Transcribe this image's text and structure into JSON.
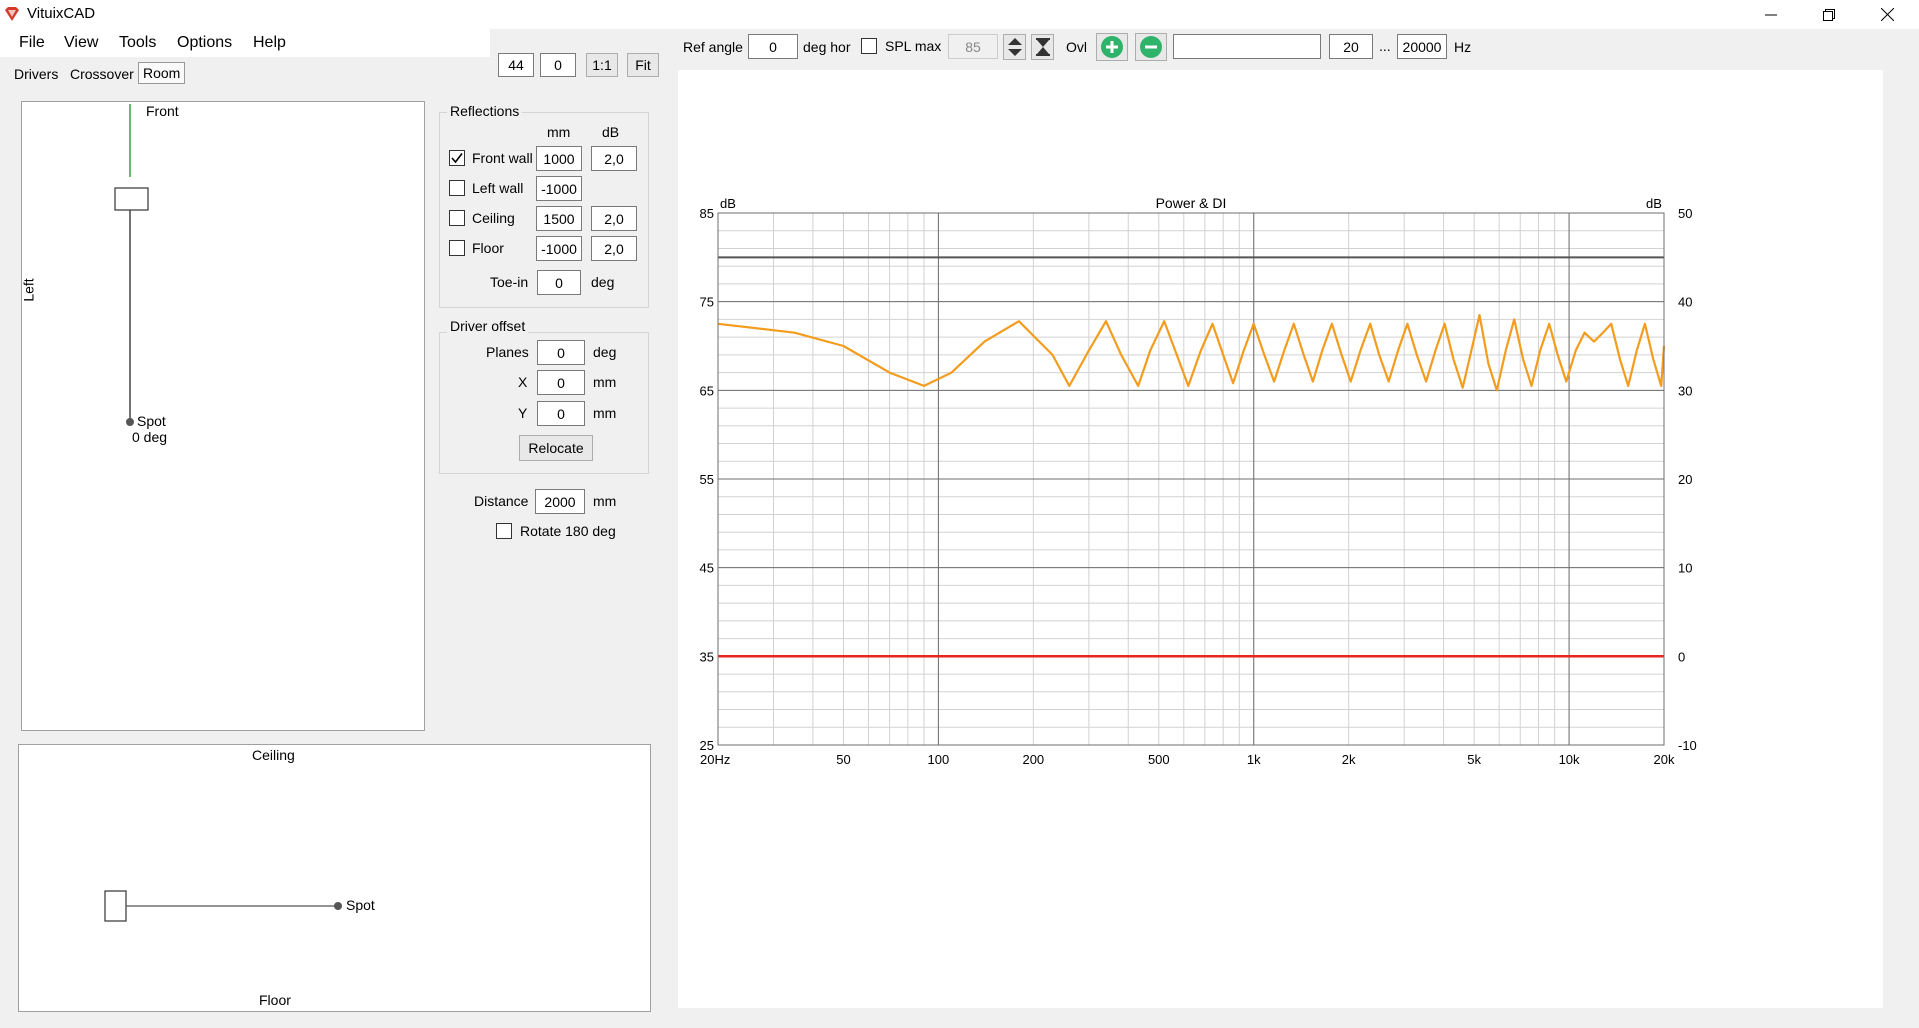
{
  "app": {
    "title": "VituixCAD"
  },
  "menu": [
    "File",
    "View",
    "Tools",
    "Options",
    "Help"
  ],
  "tabs": [
    "Drivers",
    "Crossover",
    "Room"
  ],
  "view_controls": {
    "zoom": "44",
    "offset": "0",
    "ratio_btn": "1:1",
    "fit_btn": "Fit"
  },
  "top_toolbar": {
    "ref_angle_label": "Ref angle",
    "ref_angle_value": "0",
    "ref_angle_unit": "deg hor",
    "spl_max_label": "SPL max",
    "spl_max_value": "85",
    "ovl_label": "Ovl",
    "freq_min": "20",
    "freq_sep": "...",
    "freq_max": "20000",
    "freq_unit": "Hz"
  },
  "top_view": {
    "front_label": "Front",
    "left_label": "Left",
    "spot_label": "Spot",
    "spot_angle": "0 deg"
  },
  "side_view": {
    "ceiling_label": "Ceiling",
    "floor_label": "Floor",
    "spot_label": "Spot"
  },
  "reflections": {
    "title": "Reflections",
    "col_mm": "mm",
    "col_db": "dB",
    "rows": [
      {
        "label": "Front wall",
        "checked": true,
        "mm": "1000",
        "db": "2,0"
      },
      {
        "label": "Left wall",
        "checked": false,
        "mm": "-1000",
        "db": ""
      },
      {
        "label": "Ceiling",
        "checked": false,
        "mm": "1500",
        "db": "2,0"
      },
      {
        "label": "Floor",
        "checked": false,
        "mm": "-1000",
        "db": "2,0"
      }
    ],
    "toein_label": "Toe-in",
    "toein_value": "0",
    "toein_unit": "deg"
  },
  "driver_offset": {
    "title": "Driver offset",
    "planes_label": "Planes",
    "planes_value": "0",
    "planes_unit": "deg",
    "x_label": "X",
    "x_value": "0",
    "x_unit": "mm",
    "y_label": "Y",
    "y_value": "0",
    "y_unit": "mm",
    "relocate_btn": "Relocate"
  },
  "distance": {
    "label": "Distance",
    "value": "2000",
    "unit": "mm"
  },
  "rotate": {
    "label": "Rotate 180 deg",
    "checked": false
  },
  "colors": {
    "power": "#f39c1d",
    "di": "#e8251f",
    "grid_major": "#6e6e6e",
    "grid_minor": "#d2d2d2"
  },
  "chart_data": {
    "type": "line",
    "title": "Power & DI",
    "ylabel_left": "dB",
    "ylabel_right": "dB",
    "x_scale": "log",
    "xlim": [
      20,
      20000
    ],
    "ylim_left": [
      25,
      85
    ],
    "ylim_right": [
      -10,
      50
    ],
    "x_ticks": [
      {
        "v": 20,
        "label": "20Hz"
      },
      {
        "v": 50,
        "label": "50"
      },
      {
        "v": 100,
        "label": "100"
      },
      {
        "v": 200,
        "label": "200"
      },
      {
        "v": 500,
        "label": "500"
      },
      {
        "v": 1000,
        "label": "1k"
      },
      {
        "v": 2000,
        "label": "2k"
      },
      {
        "v": 5000,
        "label": "5k"
      },
      {
        "v": 10000,
        "label": "10k"
      },
      {
        "v": 20000,
        "label": "20k"
      }
    ],
    "y_ticks_left": [
      25,
      35,
      45,
      55,
      65,
      75,
      85
    ],
    "y_ticks_right": [
      -10,
      0,
      10,
      20,
      30,
      40,
      50
    ],
    "reference_line_left": 80,
    "grid": true,
    "series": [
      {
        "axis": "left",
        "points": [
          [
            20,
            72.5
          ],
          [
            35,
            71.5
          ],
          [
            50,
            70.0
          ],
          [
            70,
            67.0
          ],
          [
            90,
            65.5
          ],
          [
            110,
            67.0
          ],
          [
            140,
            70.5
          ],
          [
            180,
            72.8
          ],
          [
            230,
            69.0
          ],
          [
            260,
            65.5
          ],
          [
            300,
            69.5
          ],
          [
            340,
            72.8
          ],
          [
            380,
            69.0
          ],
          [
            430,
            65.5
          ],
          [
            470,
            69.5
          ],
          [
            520,
            72.8
          ],
          [
            570,
            69.0
          ],
          [
            620,
            65.5
          ],
          [
            680,
            69.5
          ],
          [
            740,
            72.5
          ],
          [
            800,
            69.0
          ],
          [
            860,
            65.8
          ],
          [
            930,
            69.5
          ],
          [
            1000,
            72.5
          ],
          [
            1080,
            69.0
          ],
          [
            1160,
            66.0
          ],
          [
            1250,
            69.5
          ],
          [
            1340,
            72.5
          ],
          [
            1440,
            69.0
          ],
          [
            1540,
            66.0
          ],
          [
            1650,
            69.5
          ],
          [
            1770,
            72.5
          ],
          [
            1900,
            69.0
          ],
          [
            2030,
            66.0
          ],
          [
            2180,
            69.5
          ],
          [
            2340,
            72.5
          ],
          [
            2500,
            69.0
          ],
          [
            2680,
            66.0
          ],
          [
            2870,
            69.5
          ],
          [
            3070,
            72.5
          ],
          [
            3290,
            69.0
          ],
          [
            3520,
            66.0
          ],
          [
            3770,
            69.5
          ],
          [
            4030,
            72.5
          ],
          [
            4300,
            68.5
          ],
          [
            4600,
            65.3
          ],
          [
            4900,
            69.5
          ],
          [
            5200,
            73.5
          ],
          [
            5550,
            68.0
          ],
          [
            5900,
            65.0
          ],
          [
            6300,
            69.5
          ],
          [
            6700,
            73.0
          ],
          [
            7150,
            68.5
          ],
          [
            7600,
            65.5
          ],
          [
            8100,
            69.5
          ],
          [
            8650,
            72.5
          ],
          [
            9200,
            69.0
          ],
          [
            9800,
            66.0
          ],
          [
            10500,
            69.5
          ],
          [
            11200,
            71.5
          ],
          [
            12000,
            70.5
          ],
          [
            12800,
            71.5
          ],
          [
            13600,
            72.5
          ],
          [
            14500,
            68.5
          ],
          [
            15400,
            65.5
          ],
          [
            16400,
            69.5
          ],
          [
            17400,
            72.5
          ],
          [
            18500,
            68.5
          ],
          [
            19600,
            65.5
          ],
          [
            20000,
            70.0
          ]
        ]
      },
      {
        "axis": "right",
        "points": [
          [
            20,
            0
          ],
          [
            20000,
            0
          ]
        ]
      }
    ]
  }
}
